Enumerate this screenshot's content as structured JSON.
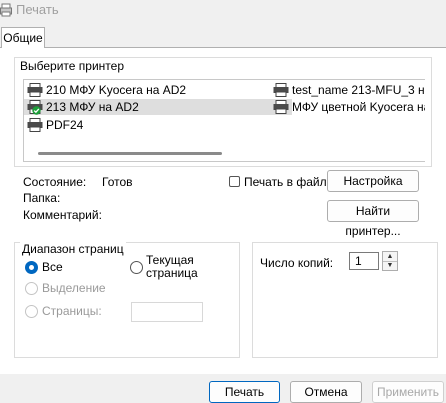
{
  "window": {
    "title": "Печать"
  },
  "tabs": [
    {
      "label": "Общие"
    }
  ],
  "printer_group": {
    "label": "Выберите принтер",
    "printers": [
      {
        "name": "210 МФУ Kyocera на AD2",
        "selected": false,
        "default": false
      },
      {
        "name": "213 МФУ на AD2",
        "selected": true,
        "default": true
      },
      {
        "name": "PDF24",
        "selected": false,
        "default": false
      },
      {
        "name": "test_name 213-MFU_3 на",
        "selected": false,
        "default": false
      },
      {
        "name": "МФУ цветной Kyocera на",
        "selected": false,
        "default": false
      }
    ]
  },
  "status": {
    "state_label": "Состояние:",
    "state_value": "Готов",
    "location_label": "Папка:",
    "comment_label": "Комментарий:"
  },
  "print_to_file_label": "Печать в файл",
  "buttons": {
    "settings": "Настройка",
    "find_printer": "Найти принтер...",
    "print": "Печать",
    "cancel": "Отмена",
    "apply": "Применить"
  },
  "page_range": {
    "label": "Диапазон страниц",
    "all": "Все",
    "selection": "Выделение",
    "current_page_line1": "Текущая",
    "current_page_line2": "страница",
    "pages": "Страницы:"
  },
  "copies": {
    "label": "Число копий:",
    "value": "1"
  },
  "colors": {
    "accent": "#0067c0",
    "selected_row": "#dedede"
  },
  "icons": [
    "printer-icon",
    "default-check-icon",
    "chevron-up-icon",
    "chevron-down-icon"
  ]
}
